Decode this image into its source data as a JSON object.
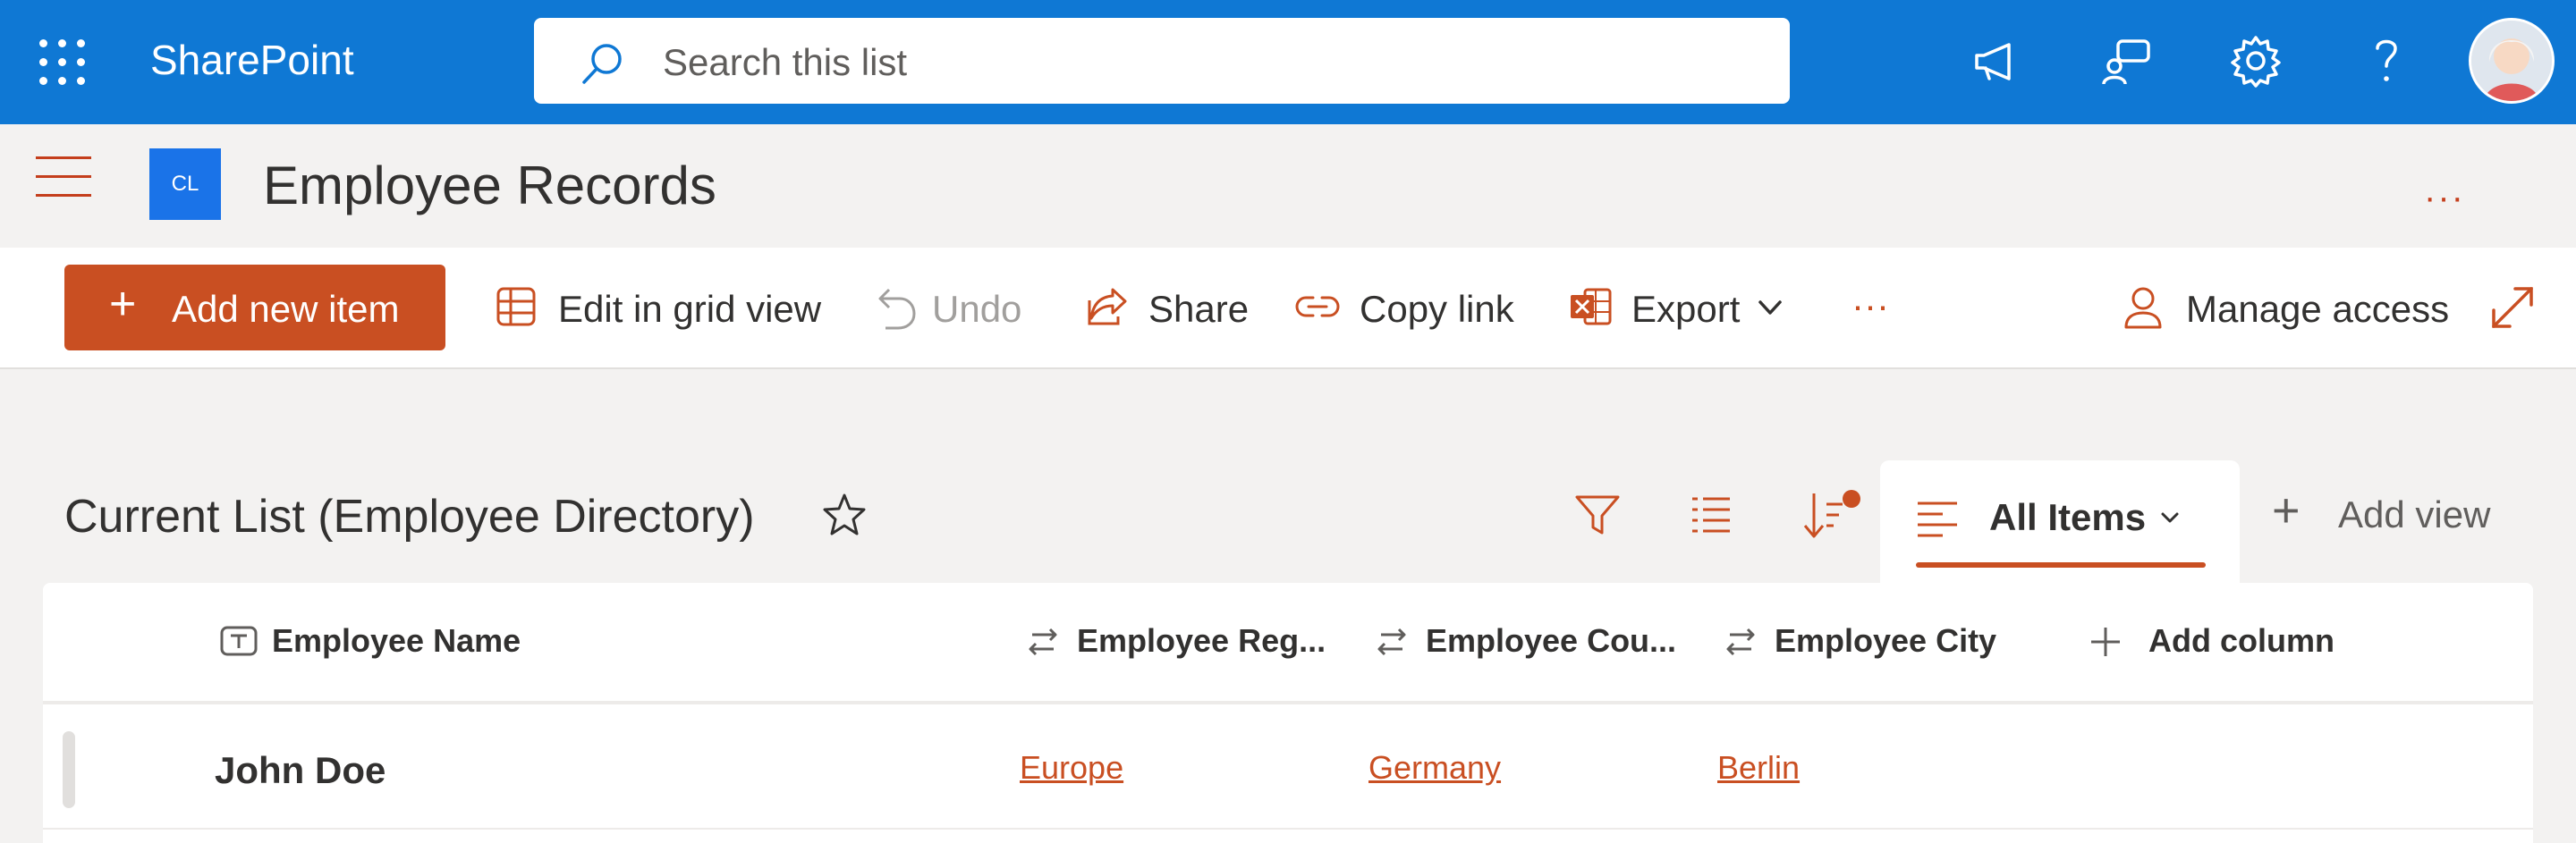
{
  "suite_bar": {
    "app_name": "SharePoint",
    "search_placeholder": "Search this list",
    "icons": [
      "waffle-icon",
      "search-icon",
      "megaphone-icon",
      "feedback-icon",
      "settings-gear-icon",
      "help-icon",
      "avatar"
    ]
  },
  "site_header": {
    "logo_text": "CL",
    "title": "Employee Records",
    "more": "···"
  },
  "command_bar": {
    "add_new_item": "Add new item",
    "edit_grid": "Edit in grid view",
    "undo": "Undo",
    "share": "Share",
    "copy_link": "Copy link",
    "export": "Export",
    "more": "···",
    "manage_access": "Manage access"
  },
  "view": {
    "title": "Current List (Employee Directory)",
    "current_view": "All Items",
    "add_view": "Add view"
  },
  "list": {
    "columns": [
      "Employee Name",
      "Employee Reg...",
      "Employee Cou...",
      "Employee City",
      "Add column"
    ],
    "rows": [
      {
        "name": "John Doe",
        "region": "Europe",
        "country": "Germany",
        "city": "Berlin"
      }
    ]
  },
  "colors": {
    "suite_bar": "#0f78d4",
    "accent": "#c94f22",
    "site_logo": "#1a73e8"
  }
}
